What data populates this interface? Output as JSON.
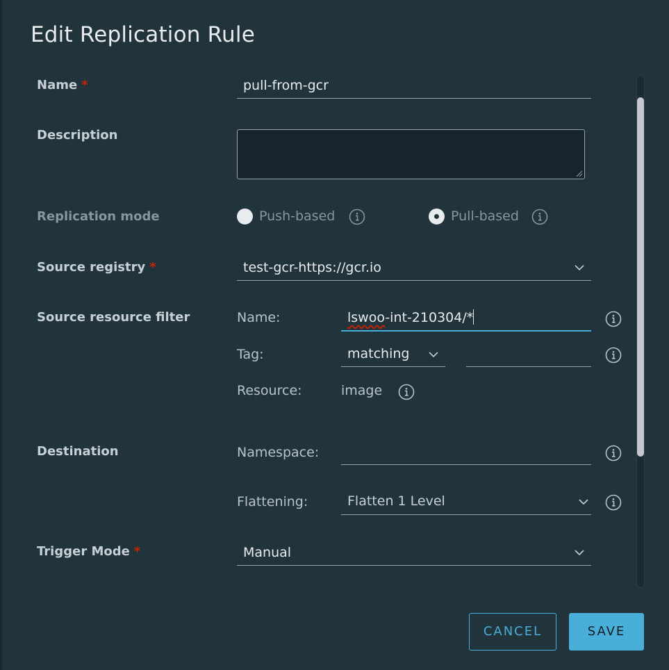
{
  "dialog": {
    "title": "Edit Replication Rule"
  },
  "form": {
    "name": {
      "label": "Name",
      "value": "pull-from-gcr"
    },
    "description": {
      "label": "Description",
      "value": ""
    },
    "replication_mode": {
      "label": "Replication mode",
      "options": [
        {
          "label": "Push-based",
          "checked": false
        },
        {
          "label": "Pull-based",
          "checked": true
        }
      ]
    },
    "source_registry": {
      "label": "Source registry",
      "value": "test-gcr-https://gcr.io"
    },
    "source_filter": {
      "label": "Source resource filter",
      "name_label": "Name:",
      "name_value_a": "lswoo",
      "name_value_b": "-int-210304/*",
      "tag_label": "Tag:",
      "tag_select": "matching",
      "tag_value": "",
      "resource_label": "Resource:",
      "resource_value": "image"
    },
    "destination": {
      "label": "Destination",
      "namespace_label": "Namespace:",
      "namespace_value": "",
      "flattening_label": "Flattening:",
      "flattening_value": "Flatten 1 Level"
    },
    "trigger_mode": {
      "label": "Trigger Mode",
      "value": "Manual"
    },
    "required_marker": "*"
  },
  "buttons": {
    "cancel": "CANCEL",
    "save": "SAVE"
  },
  "icons": [
    "info-icon",
    "chevron-down-icon",
    "resize-grip-icon"
  ],
  "colors": {
    "accent": "#49afd9",
    "required": "#c92100",
    "background": "#21333b"
  }
}
